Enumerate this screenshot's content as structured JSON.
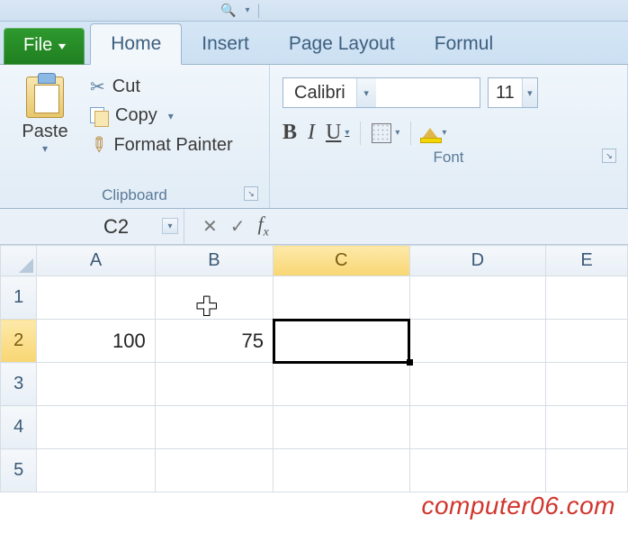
{
  "qat": {
    "tools": [
      "magnifier",
      "dropdown"
    ]
  },
  "tabs": {
    "file": "File",
    "items": [
      "Home",
      "Insert",
      "Page Layout",
      "Formul"
    ],
    "active_index": 0
  },
  "ribbon": {
    "clipboard": {
      "paste": "Paste",
      "cut": "Cut",
      "copy": "Copy",
      "format_painter": "Format Painter",
      "group_label": "Clipboard"
    },
    "font": {
      "font_name": "Calibri",
      "font_size": "11",
      "bold": "B",
      "italic": "I",
      "underline": "U",
      "group_label": "Font"
    }
  },
  "formula_bar": {
    "name_box": "C2",
    "fx": "fx",
    "formula": ""
  },
  "columns": [
    "A",
    "B",
    "C",
    "D",
    "E"
  ],
  "rows": [
    "1",
    "2",
    "3",
    "4",
    "5"
  ],
  "selected_cell": "C2",
  "cells": {
    "A2": "100",
    "B2": "75"
  },
  "watermark": "computer06.com"
}
